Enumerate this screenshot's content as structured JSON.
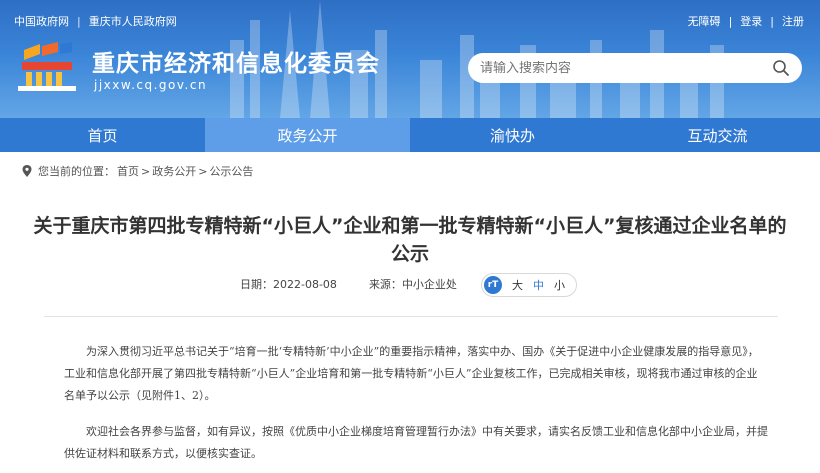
{
  "header": {
    "top_links": [
      "中国政府网",
      "重庆市人民政府网"
    ],
    "user_links": [
      "无障碍",
      "登录",
      "注册"
    ],
    "site_title": "重庆市经济和信息化委员会",
    "site_domain": "jjxxw.cq.gov.cn",
    "search_placeholder": "请输入搜索内容"
  },
  "nav": {
    "items": [
      "首页",
      "政务公开",
      "渝快办",
      "互动交流"
    ],
    "active_index": 1
  },
  "breadcrumb": {
    "prefix": "您当前的位置：",
    "items": [
      "首页",
      "政务公开",
      "公示公告"
    ]
  },
  "article": {
    "title": "关于重庆市第四批专精特新“小巨人”企业和第一批专精特新“小巨人”复核通过企业名单的公示",
    "date_label": "日期：",
    "date": "2022-08-08",
    "source_label": "来源：",
    "source": "中小企业处",
    "font_sizes": [
      "大",
      "中",
      "小"
    ],
    "paragraphs": [
      "为深入贯彻习近平总书记关于“培育一批‘专精特新’中小企业”的重要指示精神，落实中办、国办《关于促进中小企业健康发展的指导意见》，工业和信息化部开展了第四批专精特新“小巨人”企业培育和第一批专精特新“小巨人”企业复核工作，已完成相关审核，现将我市通过审核的企业名单予以公示（见附件1、2）。",
      "欢迎社会各界参与监督，如有异议，按照《优质中小企业梯度培育管理暂行办法》中有关要求，请实名反馈工业和信息化部中小企业局，并提供佐证材料和联系方式，以便核实查证。"
    ]
  },
  "colors": {
    "header_blue": "#3a84d8",
    "nav_blue": "#2f79d3",
    "nav_active": "#5e9ee8"
  }
}
